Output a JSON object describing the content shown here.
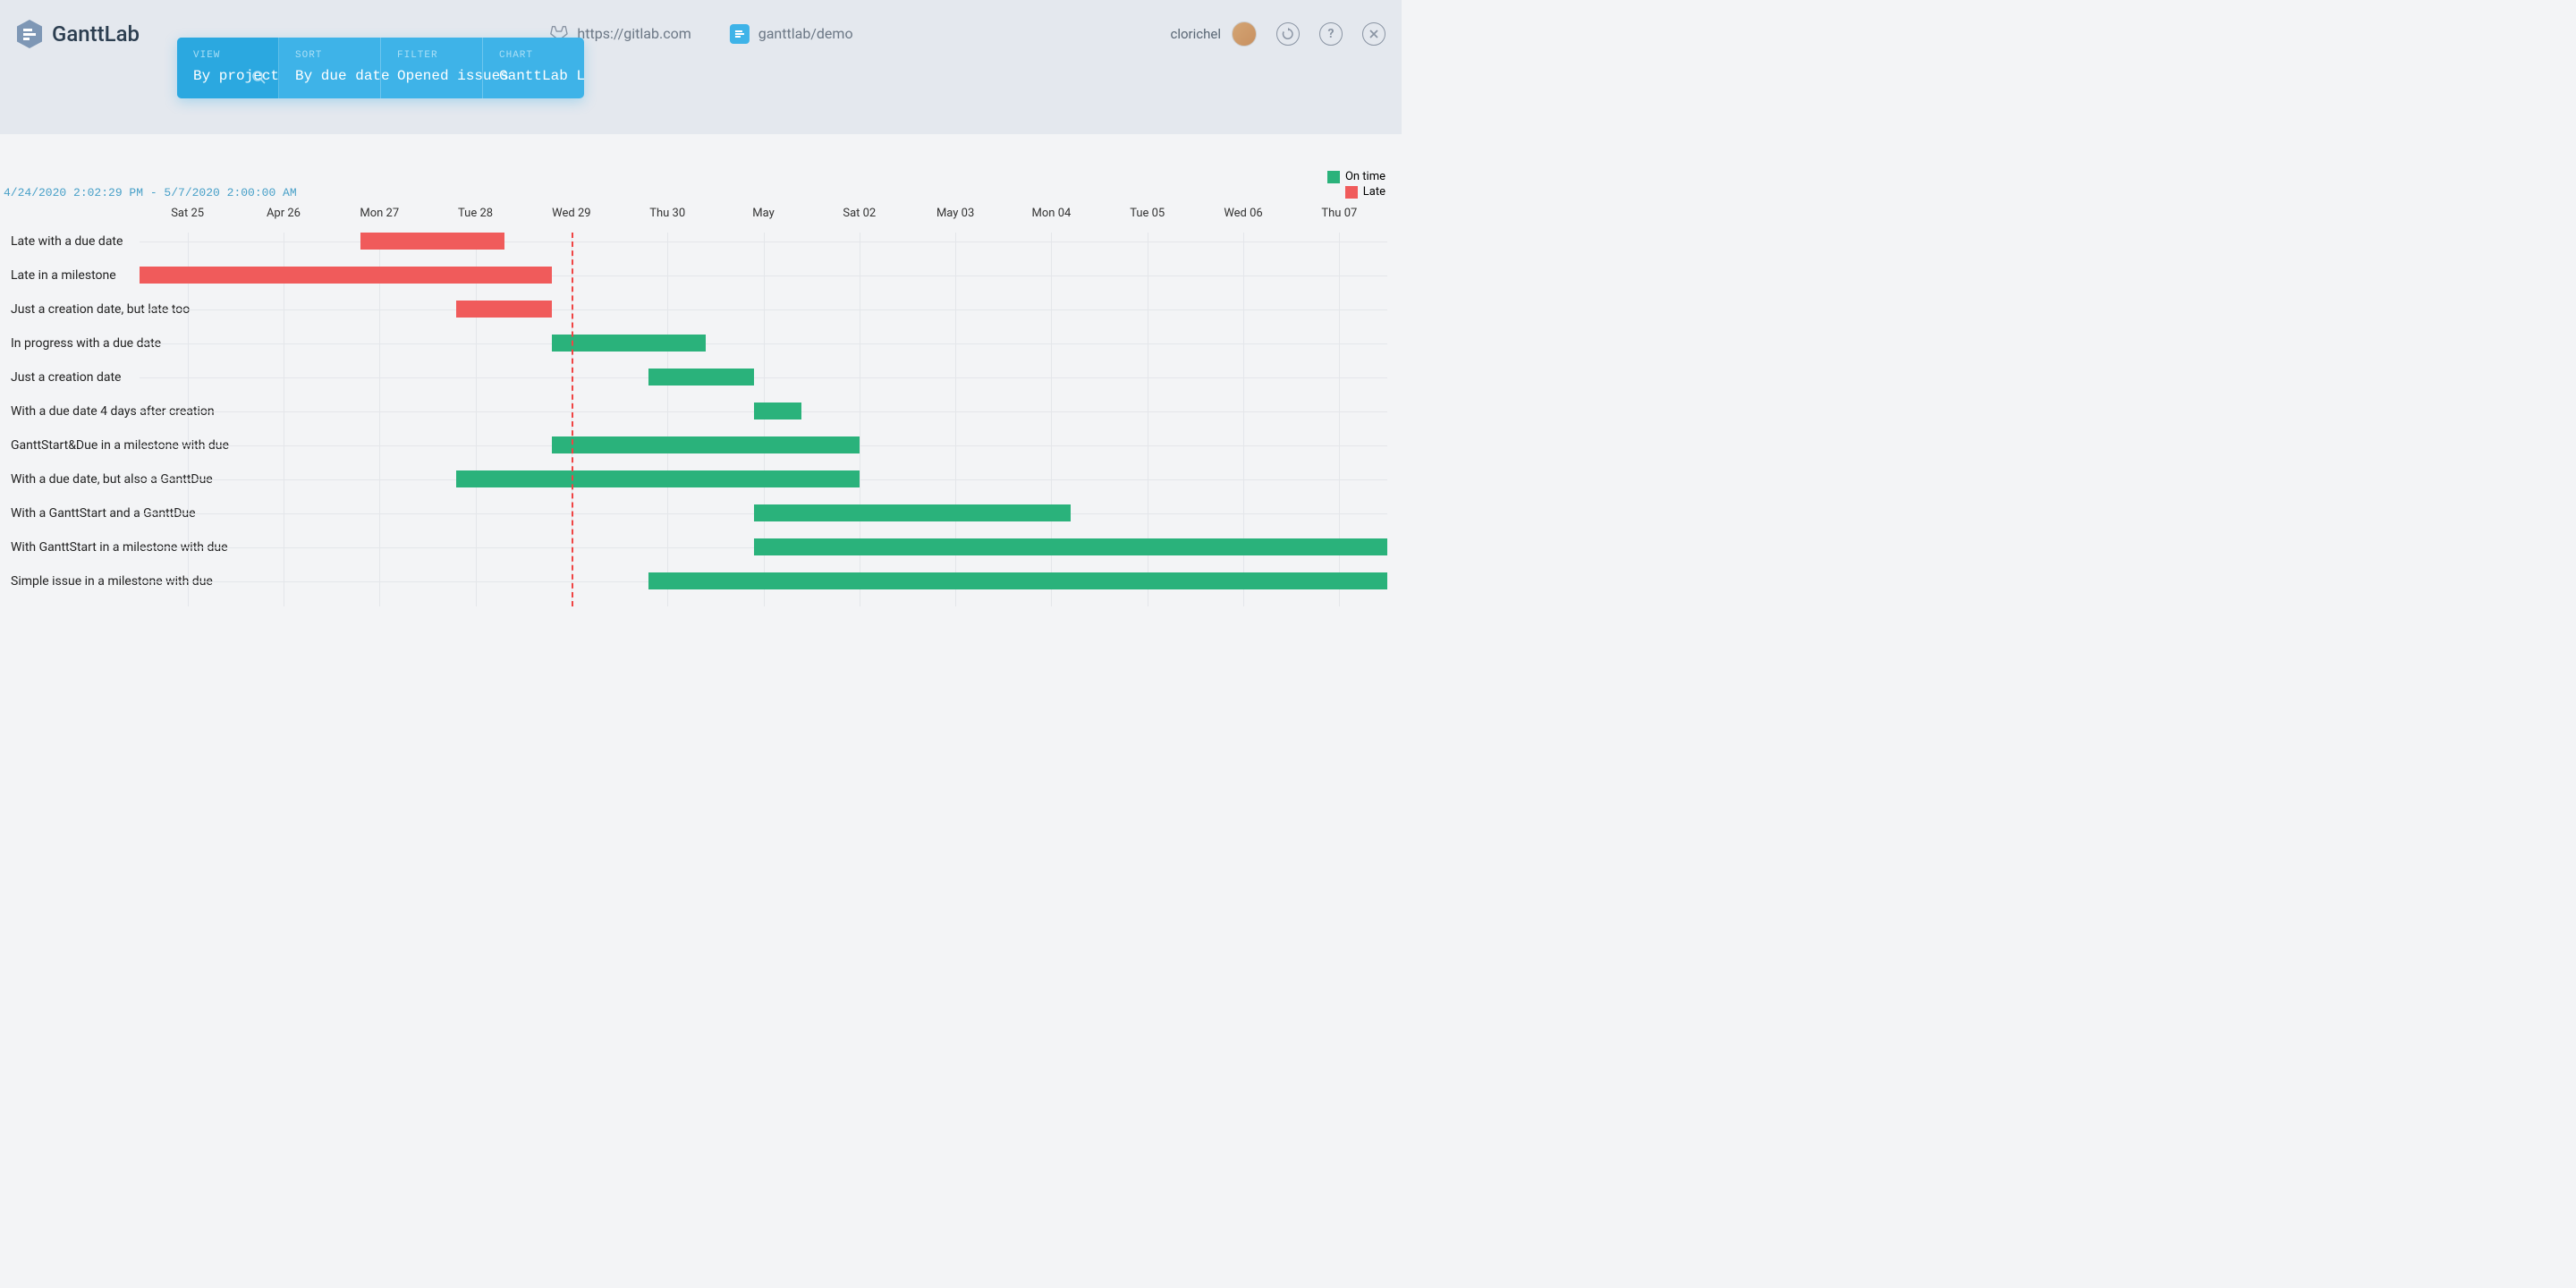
{
  "app": {
    "name": "GanttLab"
  },
  "header": {
    "gitlab_url": "https://gitlab.com",
    "project_path": "ganttlab/demo",
    "username": "clorichel"
  },
  "toolbar": {
    "view": {
      "label": "VIEW",
      "value": "By project"
    },
    "sort": {
      "label": "SORT",
      "value": "By due date"
    },
    "filter": {
      "label": "FILTER",
      "value": "Opened issues"
    },
    "chart": {
      "label": "CHART",
      "value": "GanttLab Legacy"
    }
  },
  "legend": {
    "ontime": "On time",
    "late": "Late",
    "colors": {
      "ontime": "#2ab27b",
      "late": "#f05b5b"
    }
  },
  "range_text": "4/24/2020 2:02:29 PM - 5/7/2020 2:00:00 AM",
  "chart_data": {
    "type": "gantt",
    "x_start_days": -4.5,
    "x_end_days": 8.5,
    "today": 0.0,
    "dates": [
      {
        "label": "Sat 25",
        "d": -4
      },
      {
        "label": "Apr 26",
        "d": -3
      },
      {
        "label": "Mon 27",
        "d": -2
      },
      {
        "label": "Tue 28",
        "d": -1
      },
      {
        "label": "Wed 29",
        "d": 0
      },
      {
        "label": "Thu 30",
        "d": 1
      },
      {
        "label": "May",
        "d": 2
      },
      {
        "label": "Sat 02",
        "d": 3
      },
      {
        "label": "May 03",
        "d": 4
      },
      {
        "label": "Mon 04",
        "d": 5
      },
      {
        "label": "Tue 05",
        "d": 6
      },
      {
        "label": "Wed 06",
        "d": 7
      },
      {
        "label": "Thu 07",
        "d": 8
      }
    ],
    "tasks": [
      {
        "label": "Late with a due date",
        "start": -2.2,
        "end": -0.7,
        "status": "late"
      },
      {
        "label": "Late in a milestone",
        "start": -4.5,
        "end": -0.2,
        "status": "late"
      },
      {
        "label": "Just a creation date, but late too",
        "start": -1.2,
        "end": -0.2,
        "status": "late"
      },
      {
        "label": "In progress with a due date",
        "start": -0.2,
        "end": 1.4,
        "status": "ontime"
      },
      {
        "label": "Just a creation date",
        "start": 0.8,
        "end": 1.9,
        "status": "ontime"
      },
      {
        "label": "With a due date 4 days after creation",
        "start": 1.9,
        "end": 2.4,
        "status": "ontime"
      },
      {
        "label": "GanttStart&Due in a milestone with due",
        "start": -0.2,
        "end": 3.0,
        "status": "ontime"
      },
      {
        "label": "With a due date, but also a GanttDue",
        "start": -1.2,
        "end": 3.0,
        "status": "ontime"
      },
      {
        "label": "With a GanttStart and a GanttDue",
        "start": 1.9,
        "end": 5.2,
        "status": "ontime"
      },
      {
        "label": "With GanttStart in a milestone with due",
        "start": 1.9,
        "end": 9.0,
        "status": "ontime"
      },
      {
        "label": "Simple issue in a milestone with due",
        "start": 0.8,
        "end": 9.0,
        "status": "ontime"
      }
    ]
  }
}
